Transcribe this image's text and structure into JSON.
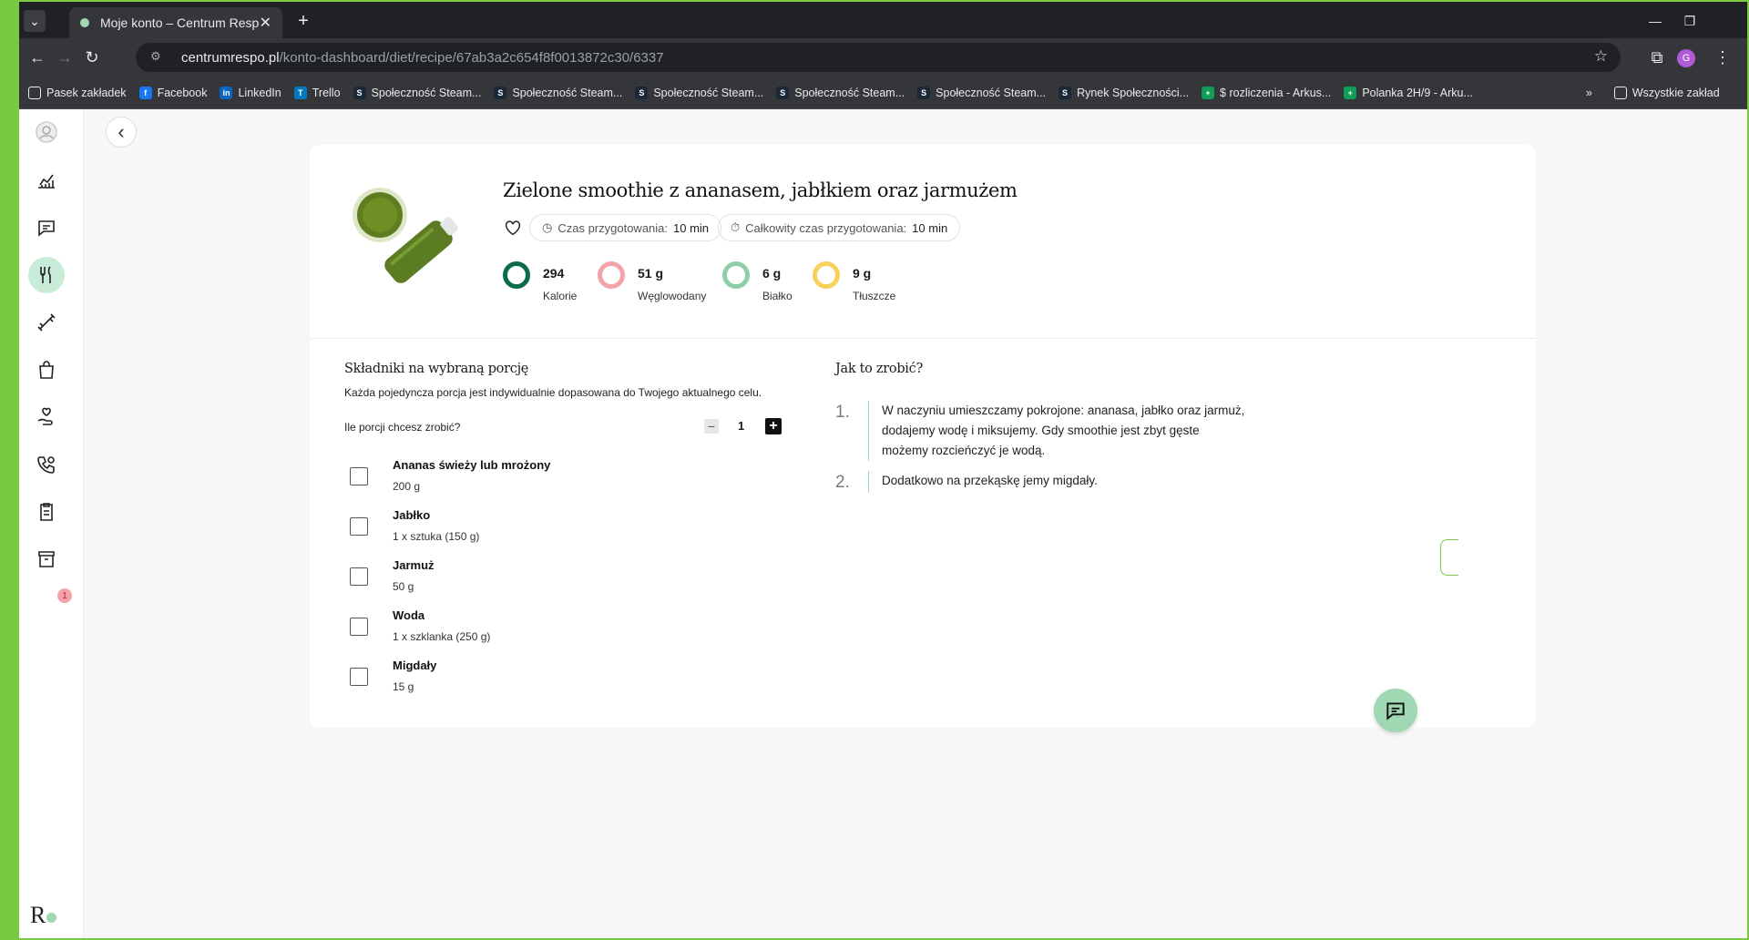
{
  "browser": {
    "tab_title": "Moje konto – Centrum Respo",
    "url_domain": "centrumrespo.pl",
    "url_path": "/konto-dashboard/diet/recipe/67ab3a2c654f8f0013872c30/6337",
    "profile_initial": "G",
    "bookmarks": [
      {
        "label": "Pasek zakładek",
        "icon": "folder-icon",
        "color": "#35363a"
      },
      {
        "label": "Facebook",
        "icon": "f",
        "color": "#1877f2"
      },
      {
        "label": "LinkedIn",
        "icon": "in",
        "color": "#0a66c2"
      },
      {
        "label": "Trello",
        "icon": "T",
        "color": "#0079bf"
      },
      {
        "label": "Społeczność Steam...",
        "icon": "S",
        "color": "#1b2838"
      },
      {
        "label": "Społeczność Steam...",
        "icon": "S",
        "color": "#1b2838"
      },
      {
        "label": "Społeczność Steam...",
        "icon": "S",
        "color": "#1b2838"
      },
      {
        "label": "Społeczność Steam...",
        "icon": "S",
        "color": "#1b2838"
      },
      {
        "label": "Społeczność Steam...",
        "icon": "S",
        "color": "#1b2838"
      },
      {
        "label": "Rynek Społeczności...",
        "icon": "S",
        "color": "#1b2838"
      },
      {
        "label": "$ rozliczenia - Arkus...",
        "icon": "+",
        "color": "#0f9d58"
      },
      {
        "label": "Polanka 2H/9 - Arku...",
        "icon": "+",
        "color": "#0f9d58"
      }
    ],
    "all_bookmarks": "Wszystkie zakład"
  },
  "sidebar": {
    "badge_count": "1",
    "logo": "R"
  },
  "recipe": {
    "title": "Zielone smoothie z ananasem, jabłkiem oraz jarmużem",
    "prep_label": "Czas przygotowania:",
    "prep_value": "10 min",
    "total_label": "Całkowity czas przygotowania:",
    "total_value": "10 min",
    "nutrition": [
      {
        "value": "294",
        "label": "Kalorie",
        "color": "#0b6b4a"
      },
      {
        "value": "51 g",
        "label": "Węglowodany",
        "color": "#f3a3a9"
      },
      {
        "value": "6 g",
        "label": "Białko",
        "color": "#8ecfa8"
      },
      {
        "value": "9 g",
        "label": "Tłuszcze",
        "color": "#f8d15a"
      }
    ]
  },
  "ingredients": {
    "title": "Składniki na wybraną porcję",
    "subtitle": "Każda pojedyncza porcja jest indywidualnie dopasowana do Twojego aktualnego celu.",
    "portions_label": "Ile porcji chcesz zrobić?",
    "portions_value": "1",
    "items": [
      {
        "name": "Ananas świeży lub mrożony",
        "qty": "200 g"
      },
      {
        "name": "Jabłko",
        "qty": "1 x sztuka (150 g)"
      },
      {
        "name": "Jarmuż",
        "qty": "50 g"
      },
      {
        "name": "Woda",
        "qty": "1 x szklanka (250 g)"
      },
      {
        "name": "Migdały",
        "qty": "15 g"
      }
    ]
  },
  "steps": {
    "title": "Jak to zrobić?",
    "items": [
      {
        "num": "1.",
        "text": "W naczyniu umieszczamy pokrojone: ananasa, jabłko oraz jarmuż, dodajemy wodę i miksujemy. Gdy smoothie jest zbyt gęste możemy rozcieńczyć je wodą."
      },
      {
        "num": "2.",
        "text": "Dodatkowo na przekąskę jemy migdały."
      }
    ]
  }
}
